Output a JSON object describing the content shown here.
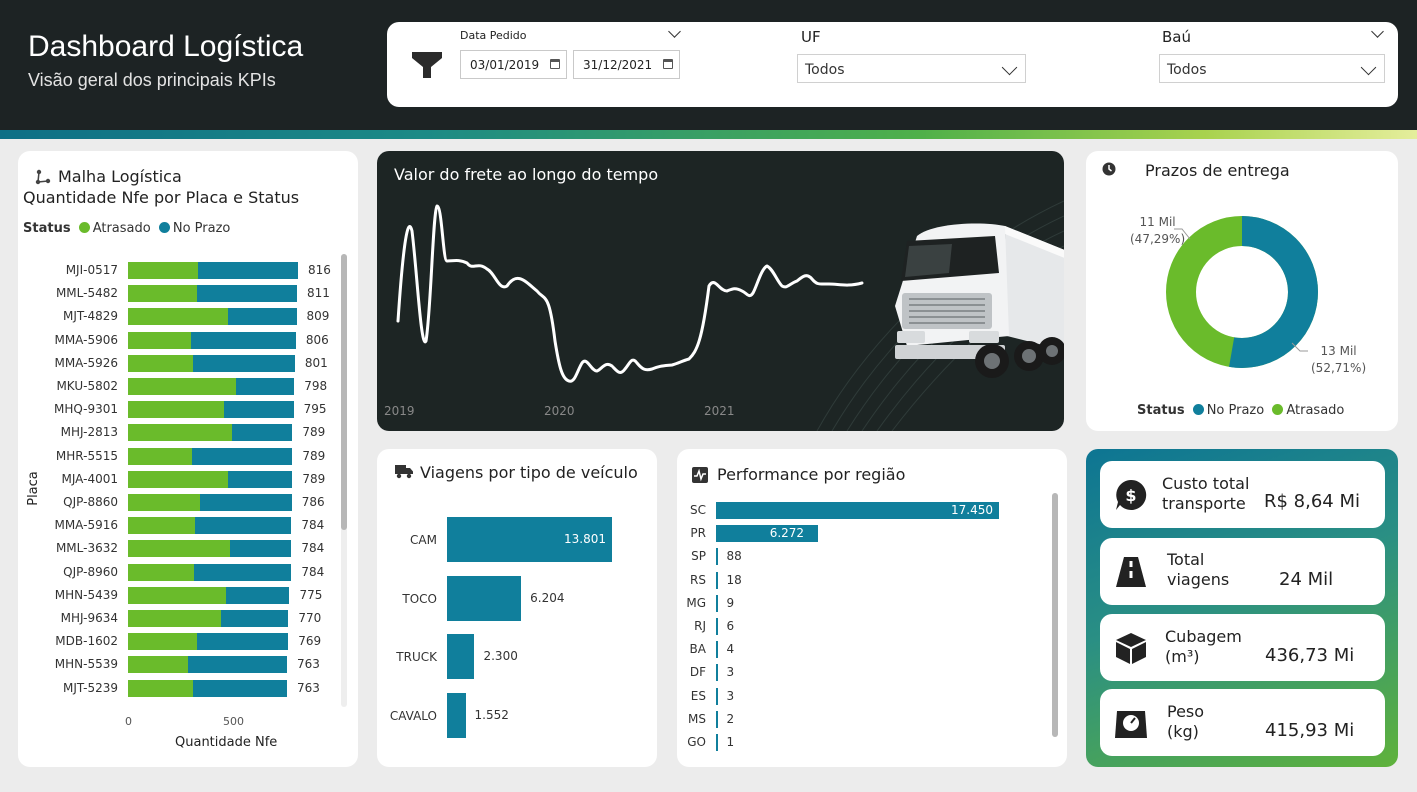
{
  "header": {
    "title": "Dashboard Logística",
    "subtitle": "Visão geral dos principais KPIs"
  },
  "filters": {
    "date_label": "Data Pedido",
    "date_start": "03/01/2019",
    "date_end": "31/12/2021",
    "uf_label": "UF",
    "uf_value": "Todos",
    "bau_label": "Baú",
    "bau_value": "Todos"
  },
  "malha": {
    "title": "Malha Logística",
    "subtitle": "Quantidade Nfe por Placa e Status",
    "legend_title": "Status",
    "legend_atrasado": "Atrasado",
    "legend_no_prazo": "No Prazo",
    "ylabel": "Placa",
    "xlabel": "Quantidade Nfe",
    "xticks": [
      "0",
      "500"
    ],
    "rows": [
      {
        "placa": "MJI-0517",
        "atrasado": 335,
        "total": 816,
        "label": "816"
      },
      {
        "placa": "MML-5482",
        "atrasado": 330,
        "total": 811,
        "label": "811"
      },
      {
        "placa": "MJT-4829",
        "atrasado": 480,
        "total": 809,
        "label": "809"
      },
      {
        "placa": "MMA-5906",
        "atrasado": 300,
        "total": 806,
        "label": "806"
      },
      {
        "placa": "MMA-5926",
        "atrasado": 310,
        "total": 801,
        "label": "801"
      },
      {
        "placa": "MKU-5802",
        "atrasado": 520,
        "total": 798,
        "label": "798"
      },
      {
        "placa": "MHQ-9301",
        "atrasado": 460,
        "total": 795,
        "label": "795"
      },
      {
        "placa": "MHJ-2813",
        "atrasado": 500,
        "total": 789,
        "label": "789"
      },
      {
        "placa": "MHR-5515",
        "atrasado": 305,
        "total": 789,
        "label": "789"
      },
      {
        "placa": "MJA-4001",
        "atrasado": 480,
        "total": 789,
        "label": "789"
      },
      {
        "placa": "QJP-8860",
        "atrasado": 345,
        "total": 786,
        "label": "786"
      },
      {
        "placa": "MMA-5916",
        "atrasado": 320,
        "total": 784,
        "label": "784"
      },
      {
        "placa": "MML-3632",
        "atrasado": 490,
        "total": 784,
        "label": "784"
      },
      {
        "placa": "QJP-8960",
        "atrasado": 315,
        "total": 784,
        "label": "784"
      },
      {
        "placa": "MHN-5439",
        "atrasado": 470,
        "total": 775,
        "label": "775"
      },
      {
        "placa": "MHJ-9634",
        "atrasado": 445,
        "total": 770,
        "label": "770"
      },
      {
        "placa": "MDB-1602",
        "atrasado": 330,
        "total": 769,
        "label": "769"
      },
      {
        "placa": "MHN-5539",
        "atrasado": 290,
        "total": 763,
        "label": "763"
      },
      {
        "placa": "MJT-5239",
        "atrasado": 310,
        "total": 763,
        "label": "763"
      }
    ]
  },
  "frete": {
    "title": "Valor do frete ao longo do tempo",
    "years": [
      "2019",
      "2020",
      "2021"
    ]
  },
  "prazos": {
    "title": "Prazos de entrega",
    "atrasado_value": "11 Mil",
    "atrasado_pct": "(47,29%)",
    "no_prazo_value": "13 Mil",
    "no_prazo_pct": "(52,71%)",
    "legend_title": "Status",
    "legend_no_prazo": "No Prazo",
    "legend_atrasado": "Atrasado"
  },
  "viagens": {
    "title": "Viagens por tipo de veículo",
    "rows": [
      {
        "tipo": "CAM",
        "value": 13801,
        "label": "13.801"
      },
      {
        "tipo": "TOCO",
        "value": 6204,
        "label": "6.204"
      },
      {
        "tipo": "TRUCK",
        "value": 2300,
        "label": "2.300"
      },
      {
        "tipo": "CAVALO",
        "value": 1552,
        "label": "1.552"
      }
    ]
  },
  "regiao": {
    "title": "Performance por região",
    "rows": [
      {
        "uf": "SC",
        "value": 17450,
        "label": "17.450"
      },
      {
        "uf": "PR",
        "value": 6272,
        "label": "6.272"
      },
      {
        "uf": "SP",
        "value": 88,
        "label": "88"
      },
      {
        "uf": "RS",
        "value": 18,
        "label": "18"
      },
      {
        "uf": "MG",
        "value": 9,
        "label": "9"
      },
      {
        "uf": "RJ",
        "value": 6,
        "label": "6"
      },
      {
        "uf": "BA",
        "value": 4,
        "label": "4"
      },
      {
        "uf": "DF",
        "value": 3,
        "label": "3"
      },
      {
        "uf": "ES",
        "value": 3,
        "label": "3"
      },
      {
        "uf": "MS",
        "value": 2,
        "label": "2"
      },
      {
        "uf": "GO",
        "value": 1,
        "label": "1"
      }
    ]
  },
  "kpis": {
    "custo_label_1": "Custo total",
    "custo_label_2": "transporte",
    "custo_value": "R$ 8,64 Mi",
    "viagens_label_1": "Total",
    "viagens_label_2": "viagens",
    "viagens_value": "24 Mil",
    "cubagem_label_1": "Cubagem",
    "cubagem_label_2": "(m³)",
    "cubagem_value": "436,73 Mi",
    "peso_label_1": "Peso",
    "peso_label_2": "(kg)",
    "peso_value": "415,93 Mi"
  },
  "colors": {
    "atrasado": "#6abb2b",
    "no_prazo": "#107f9c",
    "header_bg": "#1d2324"
  }
}
